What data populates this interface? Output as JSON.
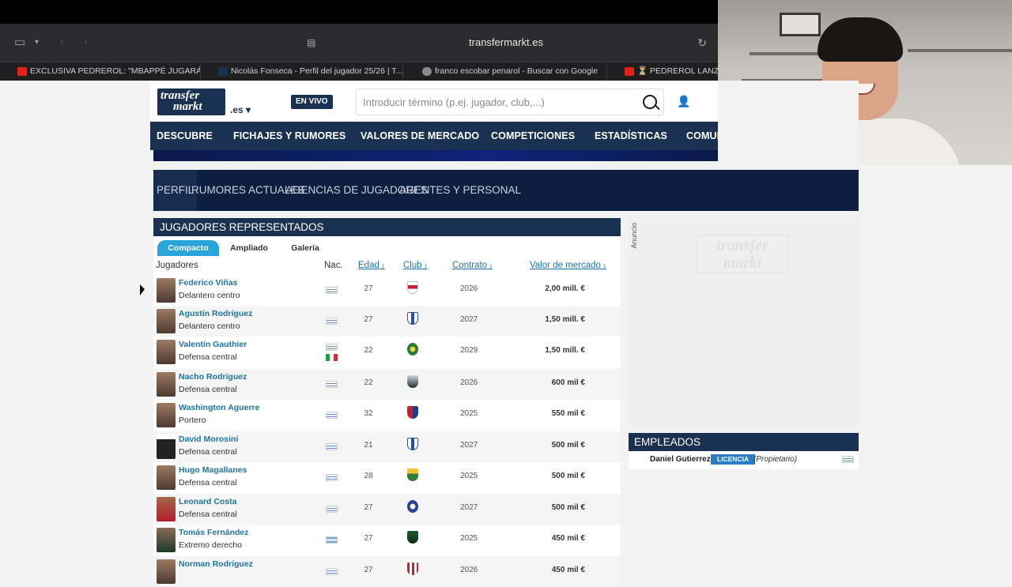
{
  "browser": {
    "url": "transfermarkt.es",
    "tabs": [
      {
        "label": "EXCLUSIVA PEDREROL: \"MBAPPÉ JUGARÁ e...",
        "favicon": "youtube"
      },
      {
        "label": "Nicolás Fonseca - Perfil del jugador 25/26 | T...",
        "favicon": "transfermarkt"
      },
      {
        "label": "franco escobar penarol - Buscar con Google",
        "favicon": "google"
      },
      {
        "label": "⏳ PEDREROL LANZA...",
        "favicon": "youtube"
      }
    ]
  },
  "header": {
    "logo_line1": "transfer",
    "logo_line2": "markt",
    "domain_suffix": ".es ▾",
    "live_label": "EN VIVO",
    "search_placeholder": "Introducir término (p.ej. jugador, club,...)"
  },
  "main_nav": [
    "DESCUBRE",
    "FICHAJES Y RUMORES",
    "VALORES DE MERCADO",
    "COMPETICIONES",
    "ESTADÍSTICAS",
    "COMUNIDAD"
  ],
  "sub_nav": [
    "PERFIL",
    "RUMORES ACTUALES",
    "AGENCIAS DE JUGADORES",
    "AGENTES Y PERSONAL"
  ],
  "players_section": {
    "title": "JUGADORES REPRESENTADOS",
    "view_tabs": [
      "Compacto",
      "Ampliado",
      "Galería"
    ],
    "columns": {
      "jugadores": "Jugadores",
      "nac": "Nac.",
      "edad": "Edad",
      "club": "Club",
      "contrato": "Contrato",
      "valor": "Valor de mercado"
    },
    "rows": [
      {
        "name": "Federico Viñas",
        "position": "Delantero centro",
        "age": "27",
        "contract": "2026",
        "value": "2,00 mill. €"
      },
      {
        "name": "Agustín Rodríguez",
        "position": "Delantero centro",
        "age": "27",
        "contract": "2027",
        "value": "1,50 mill. €"
      },
      {
        "name": "Valentín Gauthier",
        "position": "Defensa central",
        "age": "22",
        "contract": "2029",
        "value": "1,50 mill. €"
      },
      {
        "name": "Nacho Rodríguez",
        "position": "Defensa central",
        "age": "22",
        "contract": "2026",
        "value": "600 mil €"
      },
      {
        "name": "Washington Aguerre",
        "position": "Portero",
        "age": "32",
        "contract": "2025",
        "value": "550 mil €"
      },
      {
        "name": "David Morosini",
        "position": "Defensa central",
        "age": "21",
        "contract": "2027",
        "value": "500 mil €"
      },
      {
        "name": "Hugo Magallanes",
        "position": "Defensa central",
        "age": "28",
        "contract": "2025",
        "value": "500 mil €"
      },
      {
        "name": "Leonard Costa",
        "position": "Defensa central",
        "age": "27",
        "contract": "2027",
        "value": "500 mil €"
      },
      {
        "name": "Tomás Fernández",
        "position": "Extremo derecho",
        "age": "27",
        "contract": "2025",
        "value": "450 mil €"
      },
      {
        "name": "Norman Rodríguez",
        "position": "",
        "age": "27",
        "contract": "2026",
        "value": "450 mil €"
      }
    ]
  },
  "ad": {
    "label": "Anuncio",
    "logo_line1": "transfer",
    "logo_line2": "markt"
  },
  "staff": {
    "title": "EMPLEADOS",
    "name": "Daniel Gutierrez",
    "badge": "LICENCIA",
    "role": "(Propietario)"
  },
  "colors": {
    "brand_navy": "#1a3151",
    "link_blue": "#1d75a3",
    "tab_active": "#2aa5dc"
  }
}
